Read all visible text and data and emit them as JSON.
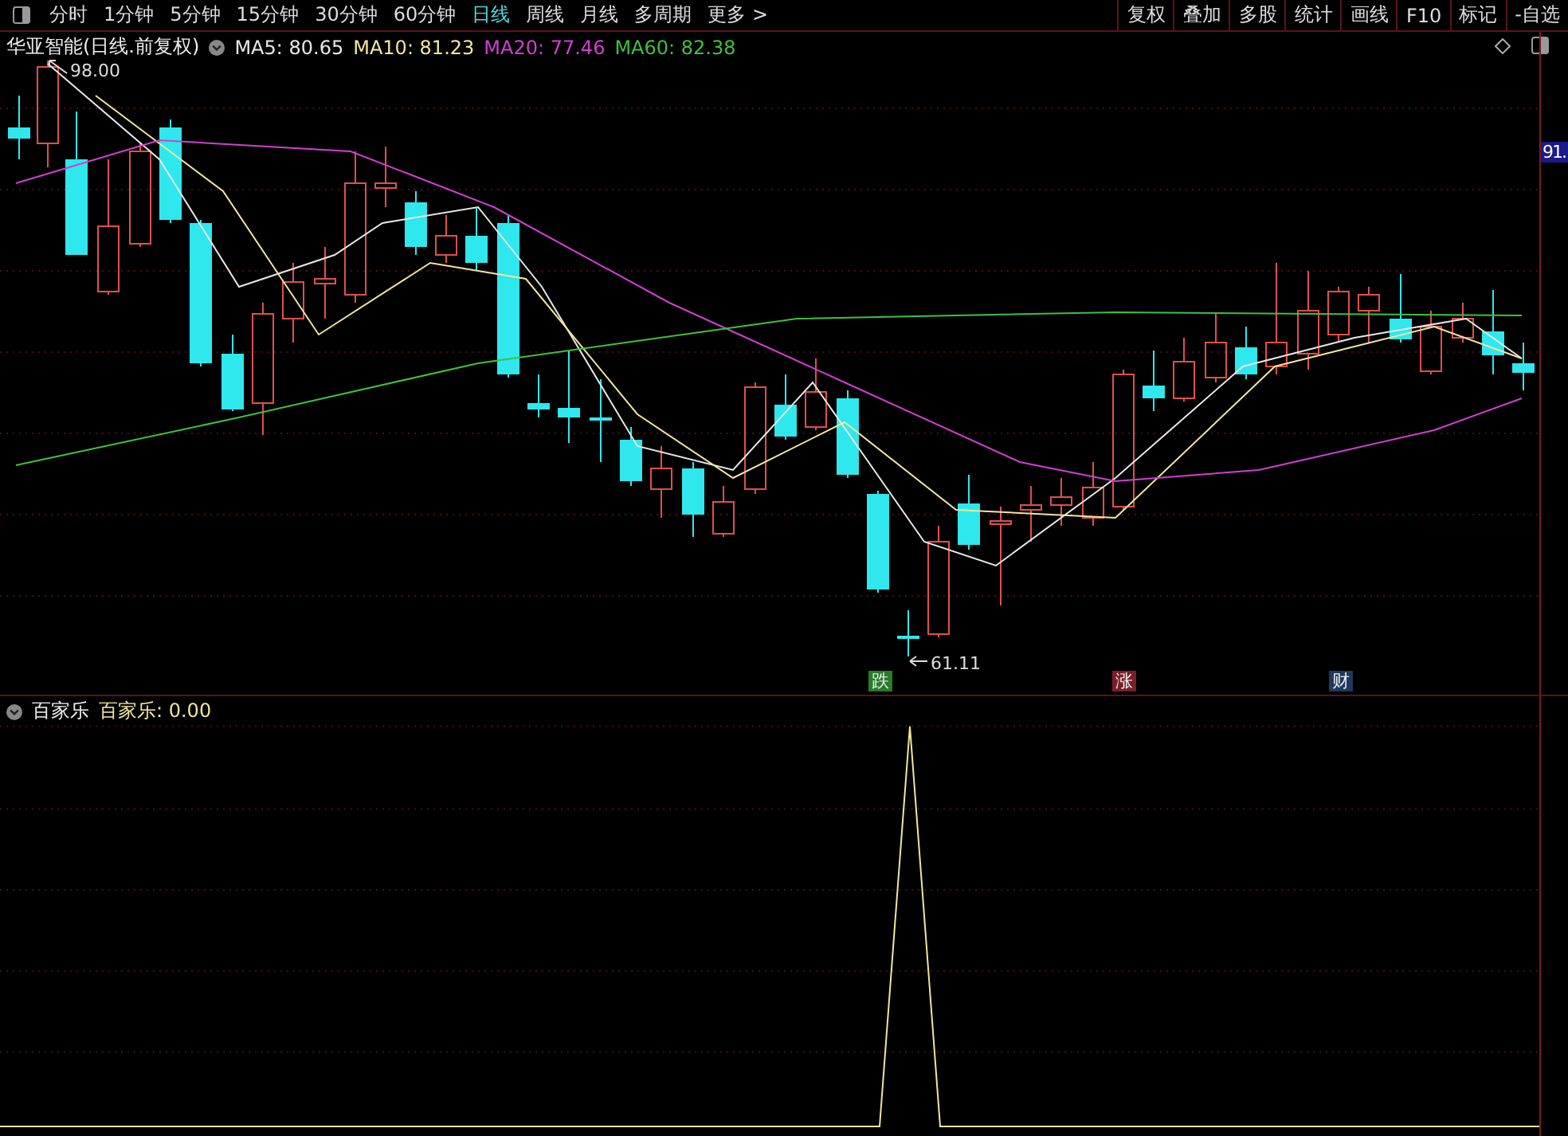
{
  "toolbar": {
    "periods": [
      {
        "label": "分时",
        "selected": false
      },
      {
        "label": "1分钟",
        "selected": false
      },
      {
        "label": "5分钟",
        "selected": false
      },
      {
        "label": "15分钟",
        "selected": false
      },
      {
        "label": "30分钟",
        "selected": false
      },
      {
        "label": "60分钟",
        "selected": false
      },
      {
        "label": "日线",
        "selected": true
      },
      {
        "label": "周线",
        "selected": false
      },
      {
        "label": "月线",
        "selected": false
      },
      {
        "label": "多周期",
        "selected": false
      },
      {
        "label": "更多 >",
        "selected": false
      }
    ],
    "tools": [
      "复权",
      "叠加",
      "多股",
      "统计",
      "画线",
      "F10",
      "标记",
      "-自选"
    ]
  },
  "main_chart": {
    "title": "华亚智能(日线.前复权)",
    "ma": [
      {
        "label": "MA5: 80.65",
        "color": "#e8e8e8"
      },
      {
        "label": "MA10: 81.23",
        "color": "#f0e6a0"
      },
      {
        "label": "MA20: 77.46",
        "color": "#d040d0"
      },
      {
        "label": "MA60: 82.38",
        "color": "#40c040"
      }
    ],
    "high_label": "98.00",
    "low_label": "61.11",
    "price_tag": "91.",
    "markers": [
      {
        "label": "跌",
        "color": "#2a7a2a"
      },
      {
        "label": "涨",
        "color": "#7a1f28"
      },
      {
        "label": "财",
        "color": "#1f3a5c"
      }
    ]
  },
  "indicator": {
    "name": "百家乐",
    "value_label": "百家乐: 0.00"
  }
}
